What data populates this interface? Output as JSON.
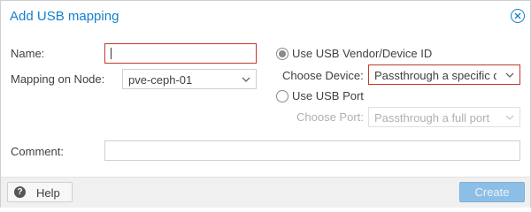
{
  "dialog": {
    "title": "Add USB mapping",
    "close_icon": "close-icon"
  },
  "form": {
    "name_label": "Name:",
    "name_value": "",
    "node_label": "Mapping on Node:",
    "node_value": "pve-ceph-01",
    "vendor_radio_label": "Use USB Vendor/Device ID",
    "vendor_radio_checked": true,
    "device_label": "Choose Device:",
    "device_value": "Passthrough a specific d",
    "port_radio_label": "Use USB Port",
    "port_radio_checked": false,
    "port_label": "Choose Port:",
    "port_value": "Passthrough a full port",
    "comment_label": "Comment:",
    "comment_value": ""
  },
  "footer": {
    "help_label": "Help",
    "help_icon": "question-icon",
    "create_label": "Create"
  },
  "colors": {
    "accent": "#157fcc",
    "invalid": "#c0392b"
  }
}
